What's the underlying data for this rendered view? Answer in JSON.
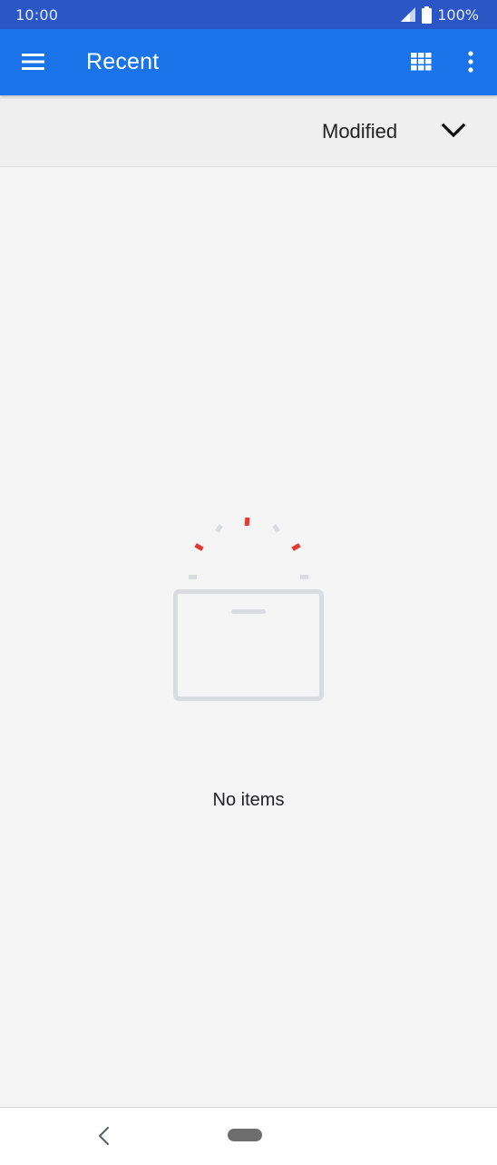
{
  "status_bar": {
    "time": "10:00",
    "battery": "100%"
  },
  "app_bar": {
    "title": "Recent",
    "icons": [
      "menu-icon",
      "grid-view-icon",
      "more-options-icon"
    ]
  },
  "sort": {
    "label": "Modified",
    "icon": "chevron-down-icon"
  },
  "empty_state": {
    "message": "No items",
    "illustration": "empty-box-icon"
  },
  "colors": {
    "status_bar": "#2a56c6",
    "app_bar": "#1a73e8",
    "accent_red": "#e53935",
    "illustration_gray": "#dadce0"
  }
}
